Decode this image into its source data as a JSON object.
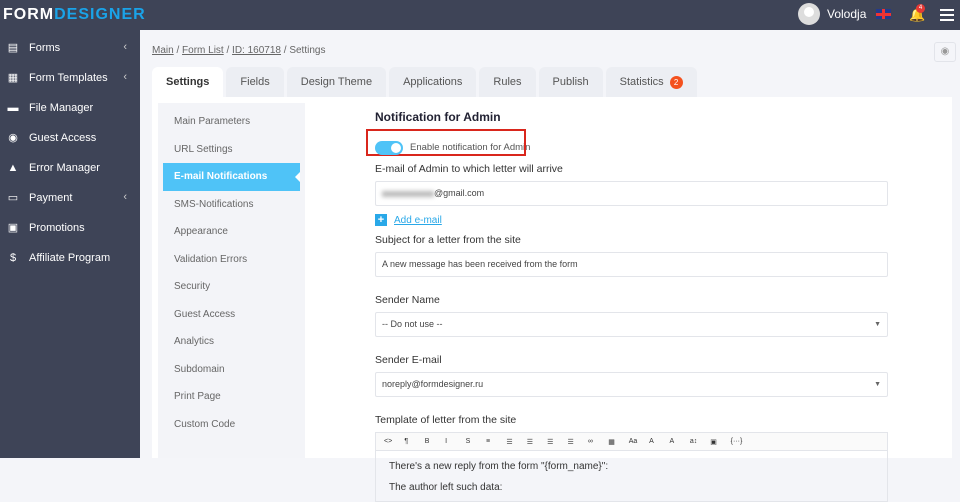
{
  "header": {
    "logo_a": "FORM",
    "logo_b": "DESIGNER",
    "user": "Volodja",
    "notifications": "4"
  },
  "sidebar": {
    "items": [
      {
        "label": "Forms",
        "icon": "forms-icon",
        "chev": true
      },
      {
        "label": "Form Templates",
        "icon": "template-icon",
        "chev": true
      },
      {
        "label": "File Manager",
        "icon": "folder-icon"
      },
      {
        "label": "Guest Access",
        "icon": "user-icon"
      },
      {
        "label": "Error Manager",
        "icon": "warning-icon"
      },
      {
        "label": "Payment",
        "icon": "card-icon",
        "chev": true
      },
      {
        "label": "Promotions",
        "icon": "gift-icon"
      },
      {
        "label": "Affiliate Program",
        "icon": "dollar-icon"
      }
    ]
  },
  "breadcrumb": {
    "main": "Main",
    "list": "Form List",
    "id": "ID: 160718",
    "current": "Settings"
  },
  "tabs": [
    {
      "label": "Settings"
    },
    {
      "label": "Fields"
    },
    {
      "label": "Design Theme"
    },
    {
      "label": "Applications"
    },
    {
      "label": "Rules"
    },
    {
      "label": "Publish"
    },
    {
      "label": "Statistics",
      "badge": "2"
    }
  ],
  "submenu": [
    "Main Parameters",
    "URL Settings",
    "E-mail Notifications",
    "SMS-Notifications",
    "Appearance",
    "Validation Errors",
    "Security",
    "Guest Access",
    "Analytics",
    "Subdomain",
    "Print Page",
    "Custom Code"
  ],
  "form": {
    "title": "Notification for Admin",
    "toggle_label": "Enable notification for Admin",
    "toggle_on": true,
    "email_label": "E-mail of Admin to which letter will arrive",
    "email_value": "@gmail.com",
    "add_email": "Add e-mail",
    "subject_label": "Subject for a letter from the site",
    "subject_value": "A new message has been received from the form",
    "sender_name_label": "Sender Name",
    "sender_name_value": "-- Do not use --",
    "sender_email_label": "Sender E-mail",
    "sender_email_value": "noreply@formdesigner.ru",
    "template_label": "Template of letter from the site",
    "toolbar": [
      "<>",
      "¶",
      "B",
      "I",
      "S",
      "≡",
      "☰",
      "☰",
      "☰",
      "☰",
      "∞",
      "▦",
      "Aa",
      "A",
      "A",
      "a↕",
      "▣",
      "{···}"
    ],
    "body_lines": [
      "There's a new reply from the form \"{form_name}\":",
      "The author left such data:"
    ]
  },
  "colors": {
    "accent": "#4fc3f7",
    "sidebar": "#3e4457",
    "highlight": "#d9261c"
  }
}
